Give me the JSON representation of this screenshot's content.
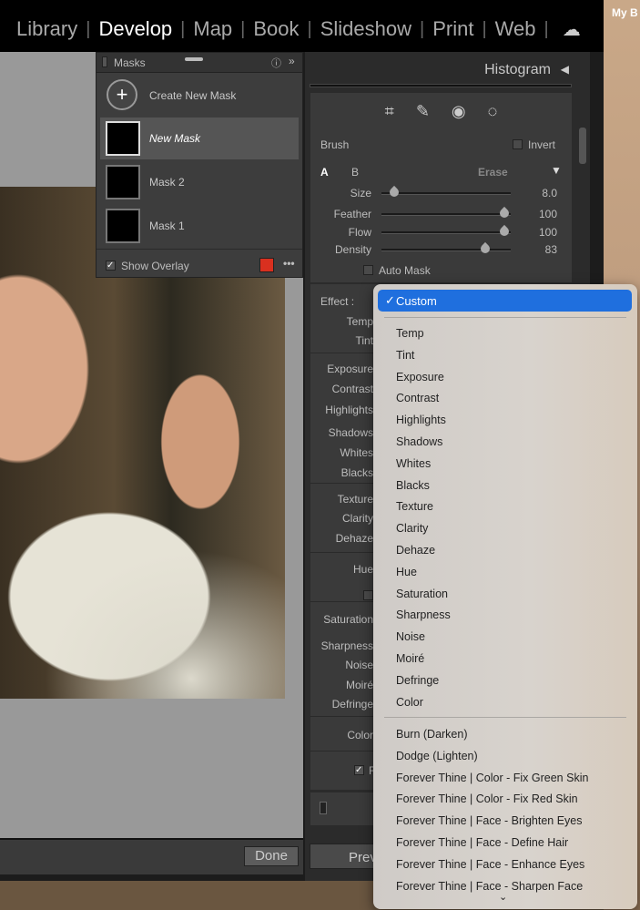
{
  "desktop": {
    "label": "My B"
  },
  "nav": {
    "items": [
      "Library",
      "Develop",
      "Map",
      "Book",
      "Slideshow",
      "Print",
      "Web"
    ],
    "active": "Develop",
    "cloud_icon": "cloud-icon"
  },
  "toolbar": {
    "done_label": "Done"
  },
  "histogram": {
    "title": "Histogram"
  },
  "tools": [
    "crop-icon",
    "healing-icon",
    "redeye-icon",
    "masking-icon"
  ],
  "masks": {
    "title": "Masks",
    "create_label": "Create New Mask",
    "items": [
      {
        "name": "New Mask",
        "selected": true
      },
      {
        "name": "Mask 2"
      },
      {
        "name": "Mask 1"
      }
    ],
    "show_overlay_label": "Show Overlay",
    "show_overlay_checked": true,
    "overlay_color": "#d9301f"
  },
  "brush": {
    "title": "Brush",
    "invert_label": "Invert",
    "a_label": "A",
    "b_label": "B",
    "erase_label": "Erase",
    "sliders": [
      {
        "label": "Size",
        "value": "8.0",
        "fraction": 0.1
      },
      {
        "label": "Feather",
        "value": "100",
        "fraction": 0.95
      },
      {
        "label": "Flow",
        "value": "100",
        "fraction": 0.95
      },
      {
        "label": "Density",
        "value": "83",
        "fraction": 0.8
      }
    ],
    "auto_mask_label": "Auto Mask"
  },
  "effect": {
    "label": "Effect :",
    "params": [
      "Temp",
      "Tint",
      "Exposure",
      "Contrast",
      "Highlights",
      "Shadows",
      "Whites",
      "Blacks",
      "Texture",
      "Clarity",
      "Dehaze",
      "Hue",
      "Saturation",
      "Sharpness",
      "Noise",
      "Moiré",
      "Defringe",
      "Color"
    ],
    "checkbox_partial": "F"
  },
  "preview": {
    "label": "Prev"
  },
  "dropdown": {
    "selected": "Custom",
    "accent": "#1f6fde",
    "group1": [
      "Temp",
      "Tint",
      "Exposure",
      "Contrast",
      "Highlights",
      "Shadows",
      "Whites",
      "Blacks",
      "Texture",
      "Clarity",
      "Dehaze",
      "Hue",
      "Saturation",
      "Sharpness",
      "Noise",
      "Moiré",
      "Defringe",
      "Color"
    ],
    "group2": [
      "Burn (Darken)",
      "Dodge (Lighten)",
      "Forever Thine | Color - Fix Green Skin",
      "Forever Thine | Color - Fix Red Skin",
      "Forever Thine | Face - Brighten Eyes",
      "Forever Thine | Face - Define Hair",
      "Forever Thine | Face - Enhance Eyes",
      "Forever Thine | Face - Sharpen Face"
    ]
  }
}
